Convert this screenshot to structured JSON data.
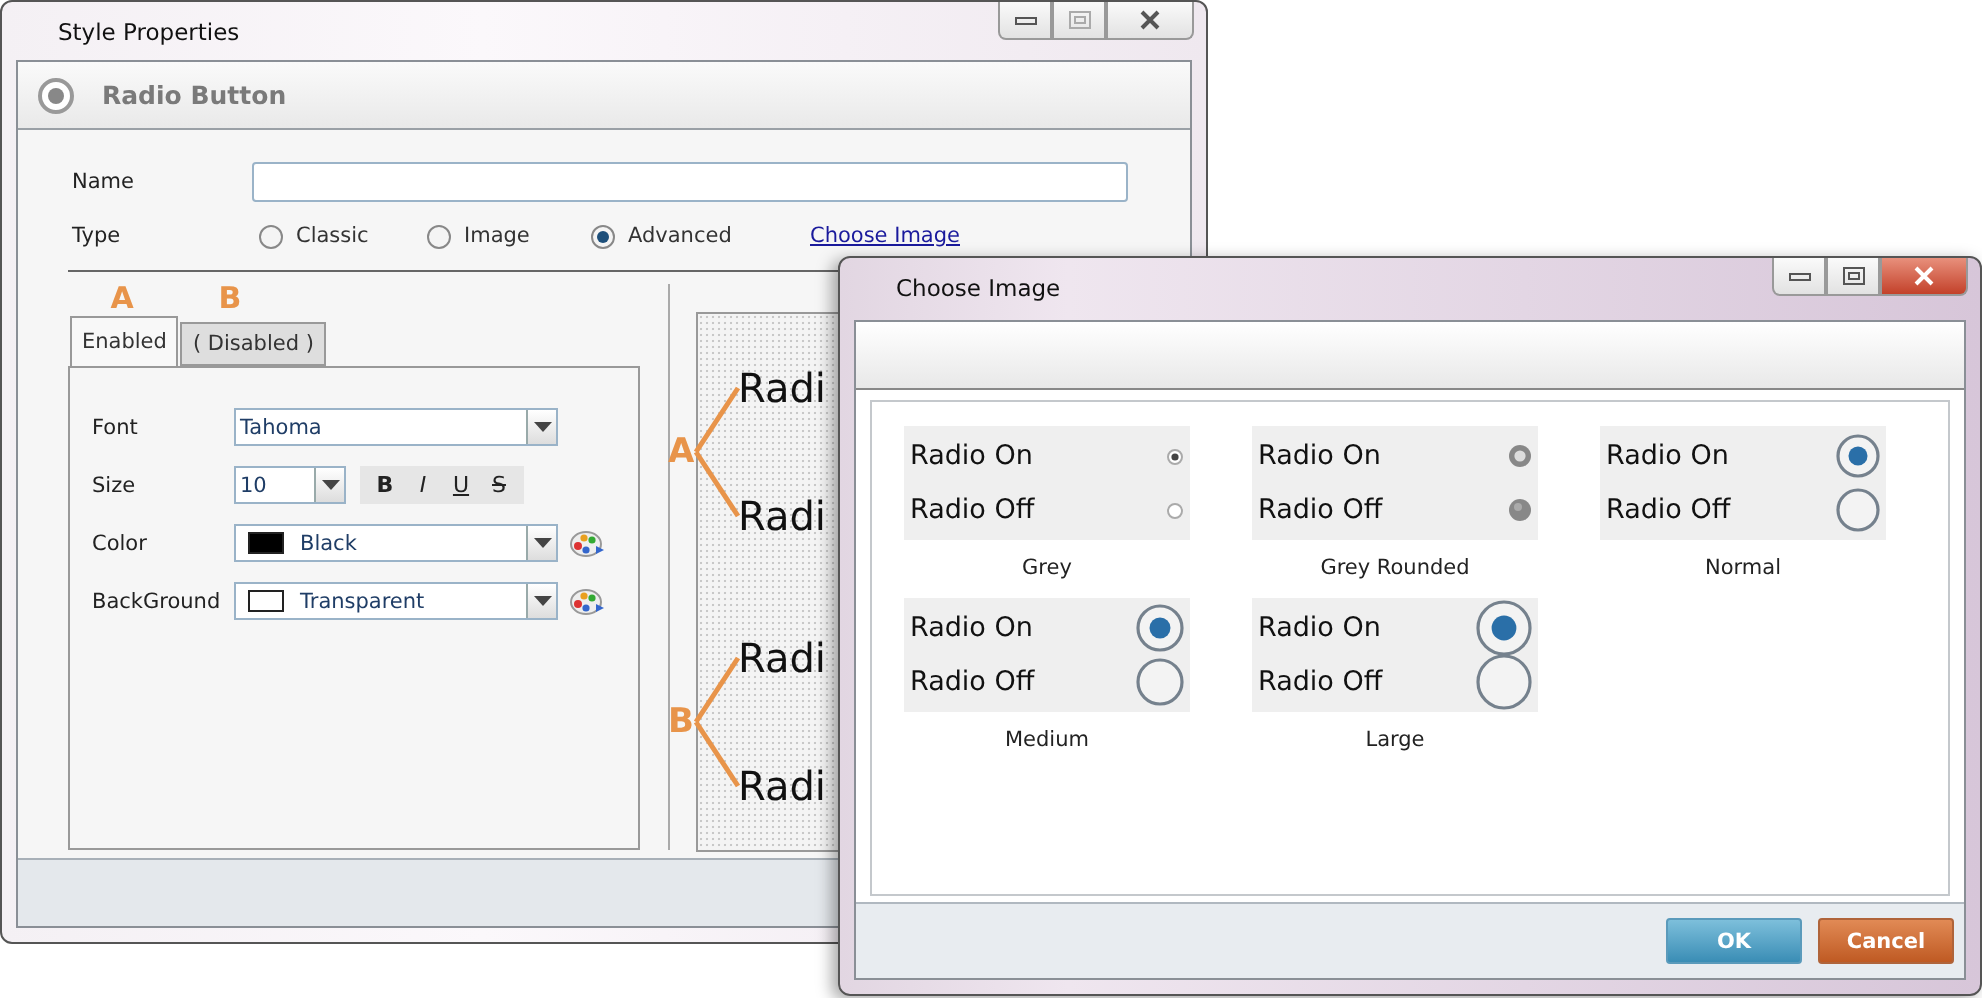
{
  "main_window": {
    "title": "Style Properties",
    "header": "Radio Button",
    "name_label": "Name",
    "type": {
      "label": "Type",
      "options": [
        {
          "label": "Classic",
          "selected": false
        },
        {
          "label": "Image",
          "selected": false
        },
        {
          "label": "Advanced",
          "selected": true
        }
      ],
      "link": "Choose Image"
    },
    "tab_marks": [
      "A",
      "B"
    ],
    "tabs": [
      {
        "label": "Enabled",
        "selected": true
      },
      {
        "label": "( Disabled )",
        "selected": false
      }
    ],
    "properties": [
      {
        "label": "Font",
        "kind": "dropdown",
        "value": "Tahoma"
      },
      {
        "label": "Size",
        "kind": "size",
        "value": "10",
        "styles": [
          {
            "label": "B",
            "kind": "bold"
          },
          {
            "label": "I",
            "kind": "italic"
          },
          {
            "label": "U",
            "kind": "underline"
          },
          {
            "label": "S",
            "kind": "strike"
          }
        ]
      },
      {
        "label": "Color",
        "kind": "color",
        "value": "Black",
        "color": "#000000"
      },
      {
        "label": "BackGround",
        "kind": "color",
        "value": "Transparent",
        "color": "#ffffff"
      }
    ],
    "preview": [
      {
        "mark": "A",
        "texts": [
          "Radi",
          "Radi"
        ]
      },
      {
        "mark": "B",
        "texts": [
          "Radi",
          "Radi"
        ]
      }
    ]
  },
  "dialog": {
    "title": "Choose Image",
    "options": [
      {
        "caption": "Grey",
        "kind": "grey",
        "rows": [
          {
            "label": "Radio On",
            "checked": true
          },
          {
            "label": "Radio Off",
            "checked": false
          }
        ]
      },
      {
        "caption": "Grey Rounded",
        "kind": "grey-rounded",
        "rows": [
          {
            "label": "Radio On",
            "checked": true
          },
          {
            "label": "Radio Off",
            "checked": false
          }
        ]
      },
      {
        "caption": "Normal",
        "kind": "normal",
        "rows": [
          {
            "label": "Radio On",
            "checked": true
          },
          {
            "label": "Radio Off",
            "checked": false
          }
        ]
      },
      {
        "caption": "Medium",
        "kind": "medium",
        "rows": [
          {
            "label": "Radio On",
            "checked": true
          },
          {
            "label": "Radio Off",
            "checked": false
          }
        ]
      },
      {
        "caption": "Large",
        "kind": "large",
        "rows": [
          {
            "label": "Radio On",
            "checked": true
          },
          {
            "label": "Radio Off",
            "checked": false
          }
        ]
      }
    ],
    "buttons": [
      {
        "label": "OK",
        "kind": "primary"
      },
      {
        "label": "Cancel",
        "kind": "cancel"
      }
    ]
  }
}
